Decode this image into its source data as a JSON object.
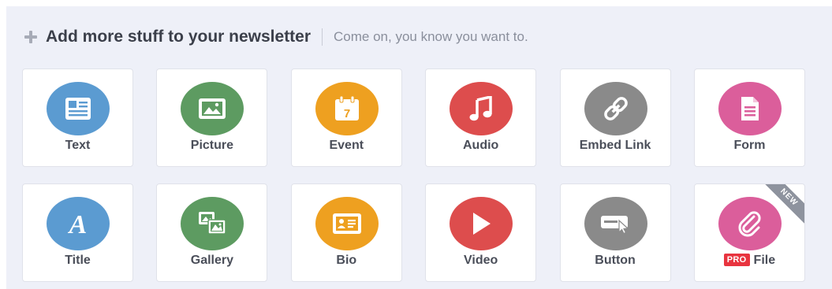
{
  "header": {
    "title": "Add more stuff to your newsletter",
    "subtitle": "Come on, you know you want to."
  },
  "tiles": [
    {
      "label": "Text",
      "icon": "text-block-icon",
      "color": "#5b9bd1"
    },
    {
      "label": "Picture",
      "icon": "picture-icon",
      "color": "#5d9b61"
    },
    {
      "label": "Event",
      "icon": "calendar-icon",
      "color": "#eea020"
    },
    {
      "label": "Audio",
      "icon": "music-note-icon",
      "color": "#dd4d4d"
    },
    {
      "label": "Embed Link",
      "icon": "link-icon",
      "color": "#8a8a8a"
    },
    {
      "label": "Form",
      "icon": "form-document-icon",
      "color": "#db5e9b"
    },
    {
      "label": "Title",
      "icon": "title-a-icon",
      "color": "#5b9bd1"
    },
    {
      "label": "Gallery",
      "icon": "gallery-icon",
      "color": "#5d9b61"
    },
    {
      "label": "Bio",
      "icon": "bio-card-icon",
      "color": "#eea020"
    },
    {
      "label": "Video",
      "icon": "play-icon",
      "color": "#dd4d4d"
    },
    {
      "label": "Button",
      "icon": "button-cursor-icon",
      "color": "#8a8a8a"
    },
    {
      "label": "File",
      "icon": "paperclip-icon",
      "color": "#db5e9b",
      "badge": "PRO",
      "ribbon": "NEW"
    }
  ]
}
